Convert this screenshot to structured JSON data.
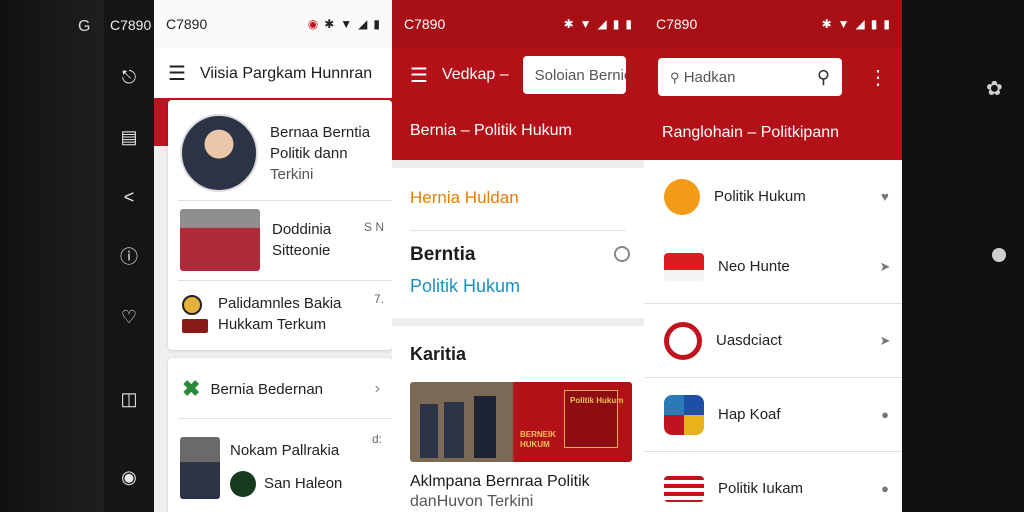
{
  "bg": {
    "left_glyph": "G"
  },
  "rail": {
    "time": "C7890"
  },
  "phone1": {
    "status_time": "C7890",
    "appbar_title": "Viisia Pargkam Hunnran",
    "news": [
      {
        "line1": "Bernaa Berntia",
        "line2": "Politik dann",
        "line3": "Terkini"
      },
      {
        "line1": "Doddinia",
        "line2": "Sitteonie",
        "meta": "S N"
      },
      {
        "line1": "Palidamnles Bakia",
        "line2": "Hukkam Terkum",
        "meta": "7."
      }
    ],
    "card2": {
      "item1": "Bernia Bedernan",
      "item2_line1": "Nokam Pallrakia",
      "item2_line2": "San Haleon",
      "item2_meta": "d:"
    }
  },
  "phone2": {
    "status_time": "C7890",
    "appbar_label": "Vedkap –",
    "search_text": "Soloian Bernie",
    "sub_title": "Bernia – Politik Hukum",
    "panel1": {
      "orange_title": "Hernia Huldan",
      "title": "Berntia",
      "subtitle": "Politik Hukum"
    },
    "panel2": {
      "section_title": "Karitia",
      "image_caption_line1": "BERNEIK",
      "image_caption_line2": "HUKUM",
      "overlay_text": "Politik Hukum",
      "headline_line1": "Aklmpana Bernraa Politik",
      "headline_line2": "danHuvon Terkini"
    }
  },
  "phone3": {
    "status_time": "C7890",
    "search_text": "Hadkan",
    "sub_title": "Ranglohain – Politkipann",
    "items": [
      {
        "label": "Politik Hukum",
        "icon": "chat-bubble-icon"
      },
      {
        "label": "Neo Hunte",
        "icon": "flag-icon"
      },
      {
        "label": "Uasdciact",
        "icon": "swirl-logo-icon"
      },
      {
        "label": "Hap Koaf",
        "icon": "star-burst-icon"
      },
      {
        "label": "Politik Iukam",
        "icon": "stripes-flag-icon"
      }
    ]
  }
}
